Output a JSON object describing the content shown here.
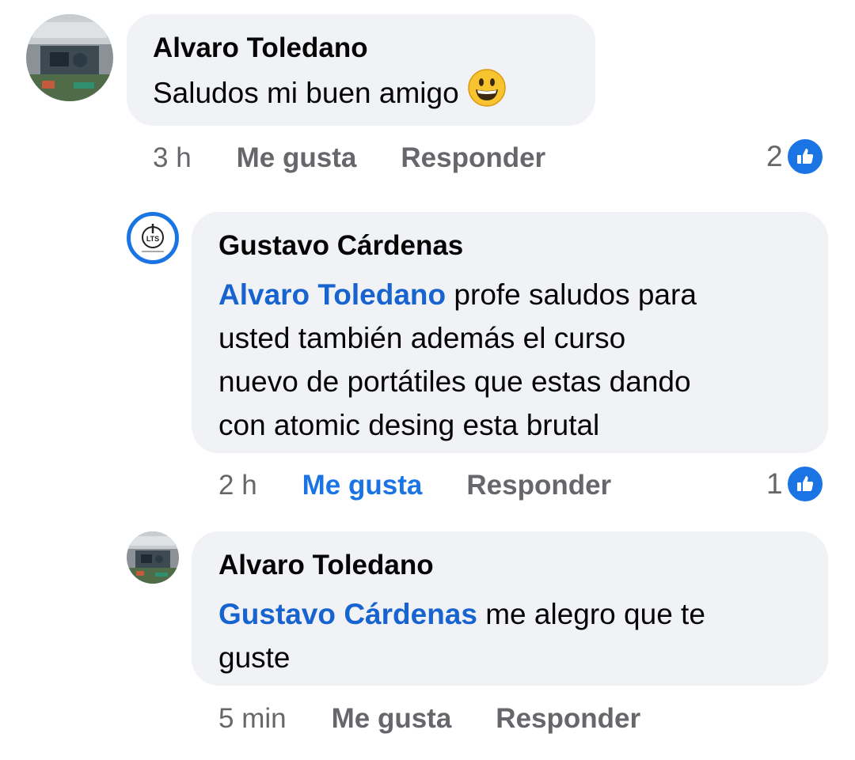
{
  "comments": [
    {
      "author": "Alvaro Toledano",
      "text": "Saludos mi buen amigo",
      "emoji": "grinning-face",
      "time": "3 h",
      "like_label": "Me gusta",
      "reply_label": "Responder",
      "reaction_count": "2",
      "avatar": "alvaro-avatar"
    },
    {
      "author": "Gustavo Cárdenas",
      "mention": "Alvaro Toledano",
      "text_lines": [
        " profe saludos para",
        "usted también además el curso",
        "nuevo de portátiles que estas dando",
        "con atomic desing esta brutal"
      ],
      "time": "2 h",
      "like_label": "Me gusta",
      "reply_label": "Responder",
      "reaction_count": "1",
      "liked": true,
      "avatar": "lts-logo-avatar",
      "avatar_text": "LTS"
    },
    {
      "author": "Alvaro Toledano",
      "mention": "Gustavo Cárdenas",
      "text_lines": [
        " me alegro que te",
        "guste"
      ],
      "time": "5 min",
      "like_label": "Me gusta",
      "reply_label": "Responder",
      "avatar": "alvaro-avatar"
    }
  ],
  "colors": {
    "bubble": "#f0f2f5",
    "mention": "#1763cf",
    "like_active": "#1b74e4",
    "meta": "#65676b"
  }
}
